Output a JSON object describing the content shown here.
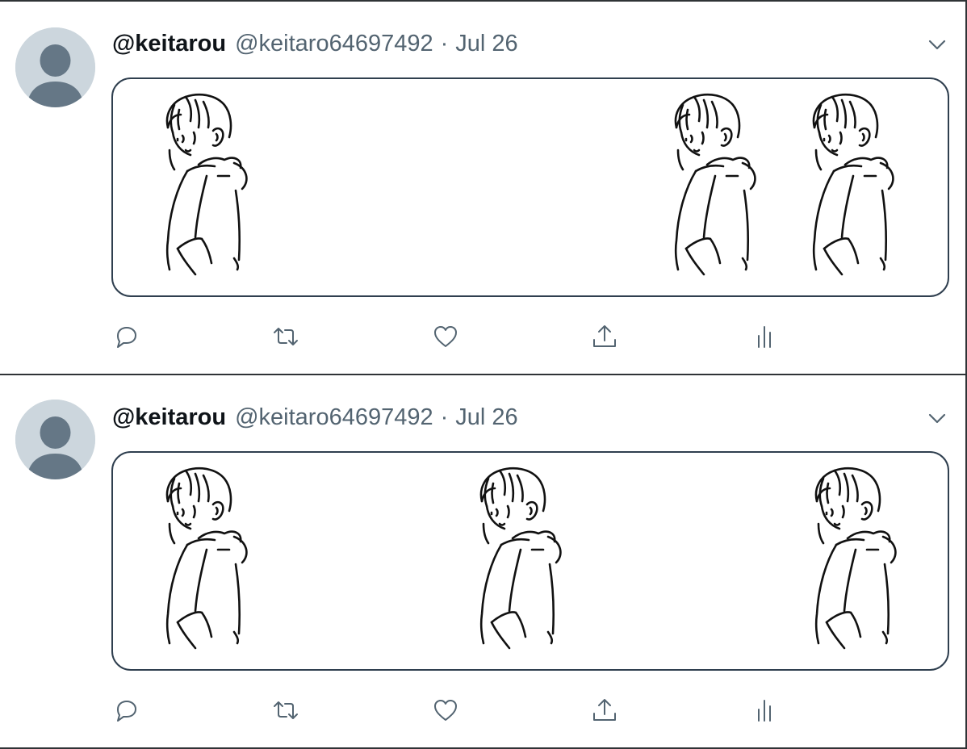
{
  "tweets": [
    {
      "display_name": "@keitarou",
      "handle": "@keitaro64697492",
      "separator": "·",
      "date": "Jul 26",
      "media": {
        "figure_count": 3,
        "alt": ""
      }
    },
    {
      "display_name": "@keitarou",
      "handle": "@keitaro64697492",
      "separator": "·",
      "date": "Jul 26",
      "media": {
        "figure_count": 3,
        "alt": ""
      }
    }
  ],
  "icons": {
    "avatar": "default-avatar-icon",
    "more": "chevron-down-icon",
    "reply": "reply-icon",
    "retweet": "retweet-icon",
    "like": "heart-icon",
    "share": "share-icon",
    "analytics": "analytics-icon"
  },
  "colors": {
    "text_primary": "#0f1419",
    "text_secondary": "#536471",
    "border": "#2f3336",
    "avatar_bg": "#ccd6dd",
    "avatar_fg": "#657786",
    "icon": "#536471"
  }
}
